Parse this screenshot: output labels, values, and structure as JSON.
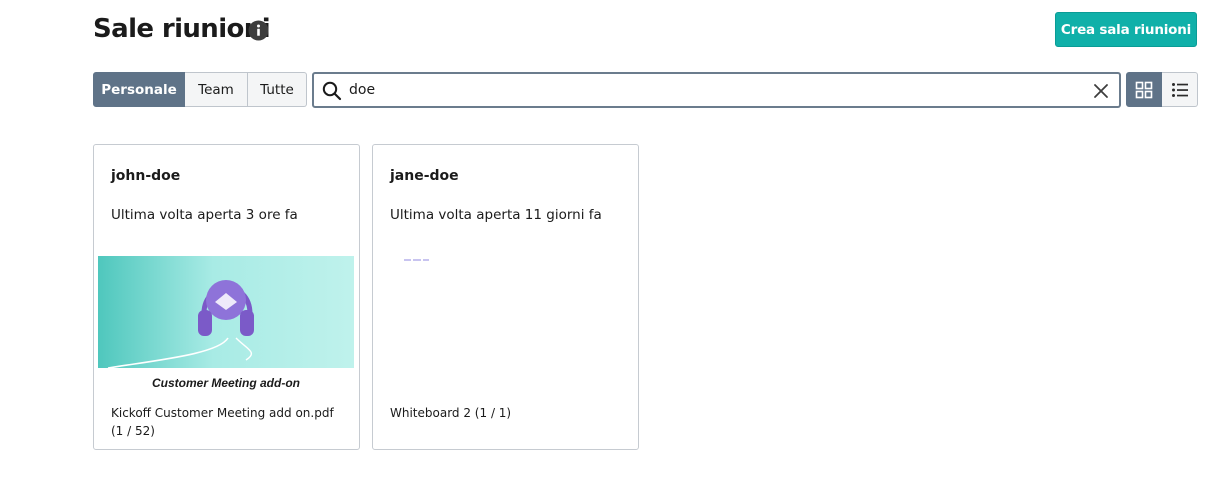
{
  "header": {
    "title": "Sale riunioni",
    "create_label": "Crea sala riunioni"
  },
  "filters": {
    "tabs": [
      {
        "label": "Personale",
        "active": true
      },
      {
        "label": "Team",
        "active": false
      },
      {
        "label": "Tutte",
        "active": false
      }
    ]
  },
  "search": {
    "value": "doe"
  },
  "view": {
    "mode": "grid"
  },
  "colors": {
    "accent": "#10b0a9",
    "segment_active": "#5f7388",
    "thumbnail_bg": "#a3e7e2",
    "headphones": "#8b6fd6"
  },
  "rooms": [
    {
      "name": "john-doe",
      "last_opened": "Ultima volta aperta 3 ore fa",
      "thumbnail_caption": "Customer Meeting add-on",
      "file": "Kickoff Customer Meeting add on.pdf (1 / 52)"
    },
    {
      "name": "jane-doe",
      "last_opened": "Ultima volta aperta 11 giorni fa",
      "file": "Whiteboard 2 (1 / 1)"
    }
  ]
}
